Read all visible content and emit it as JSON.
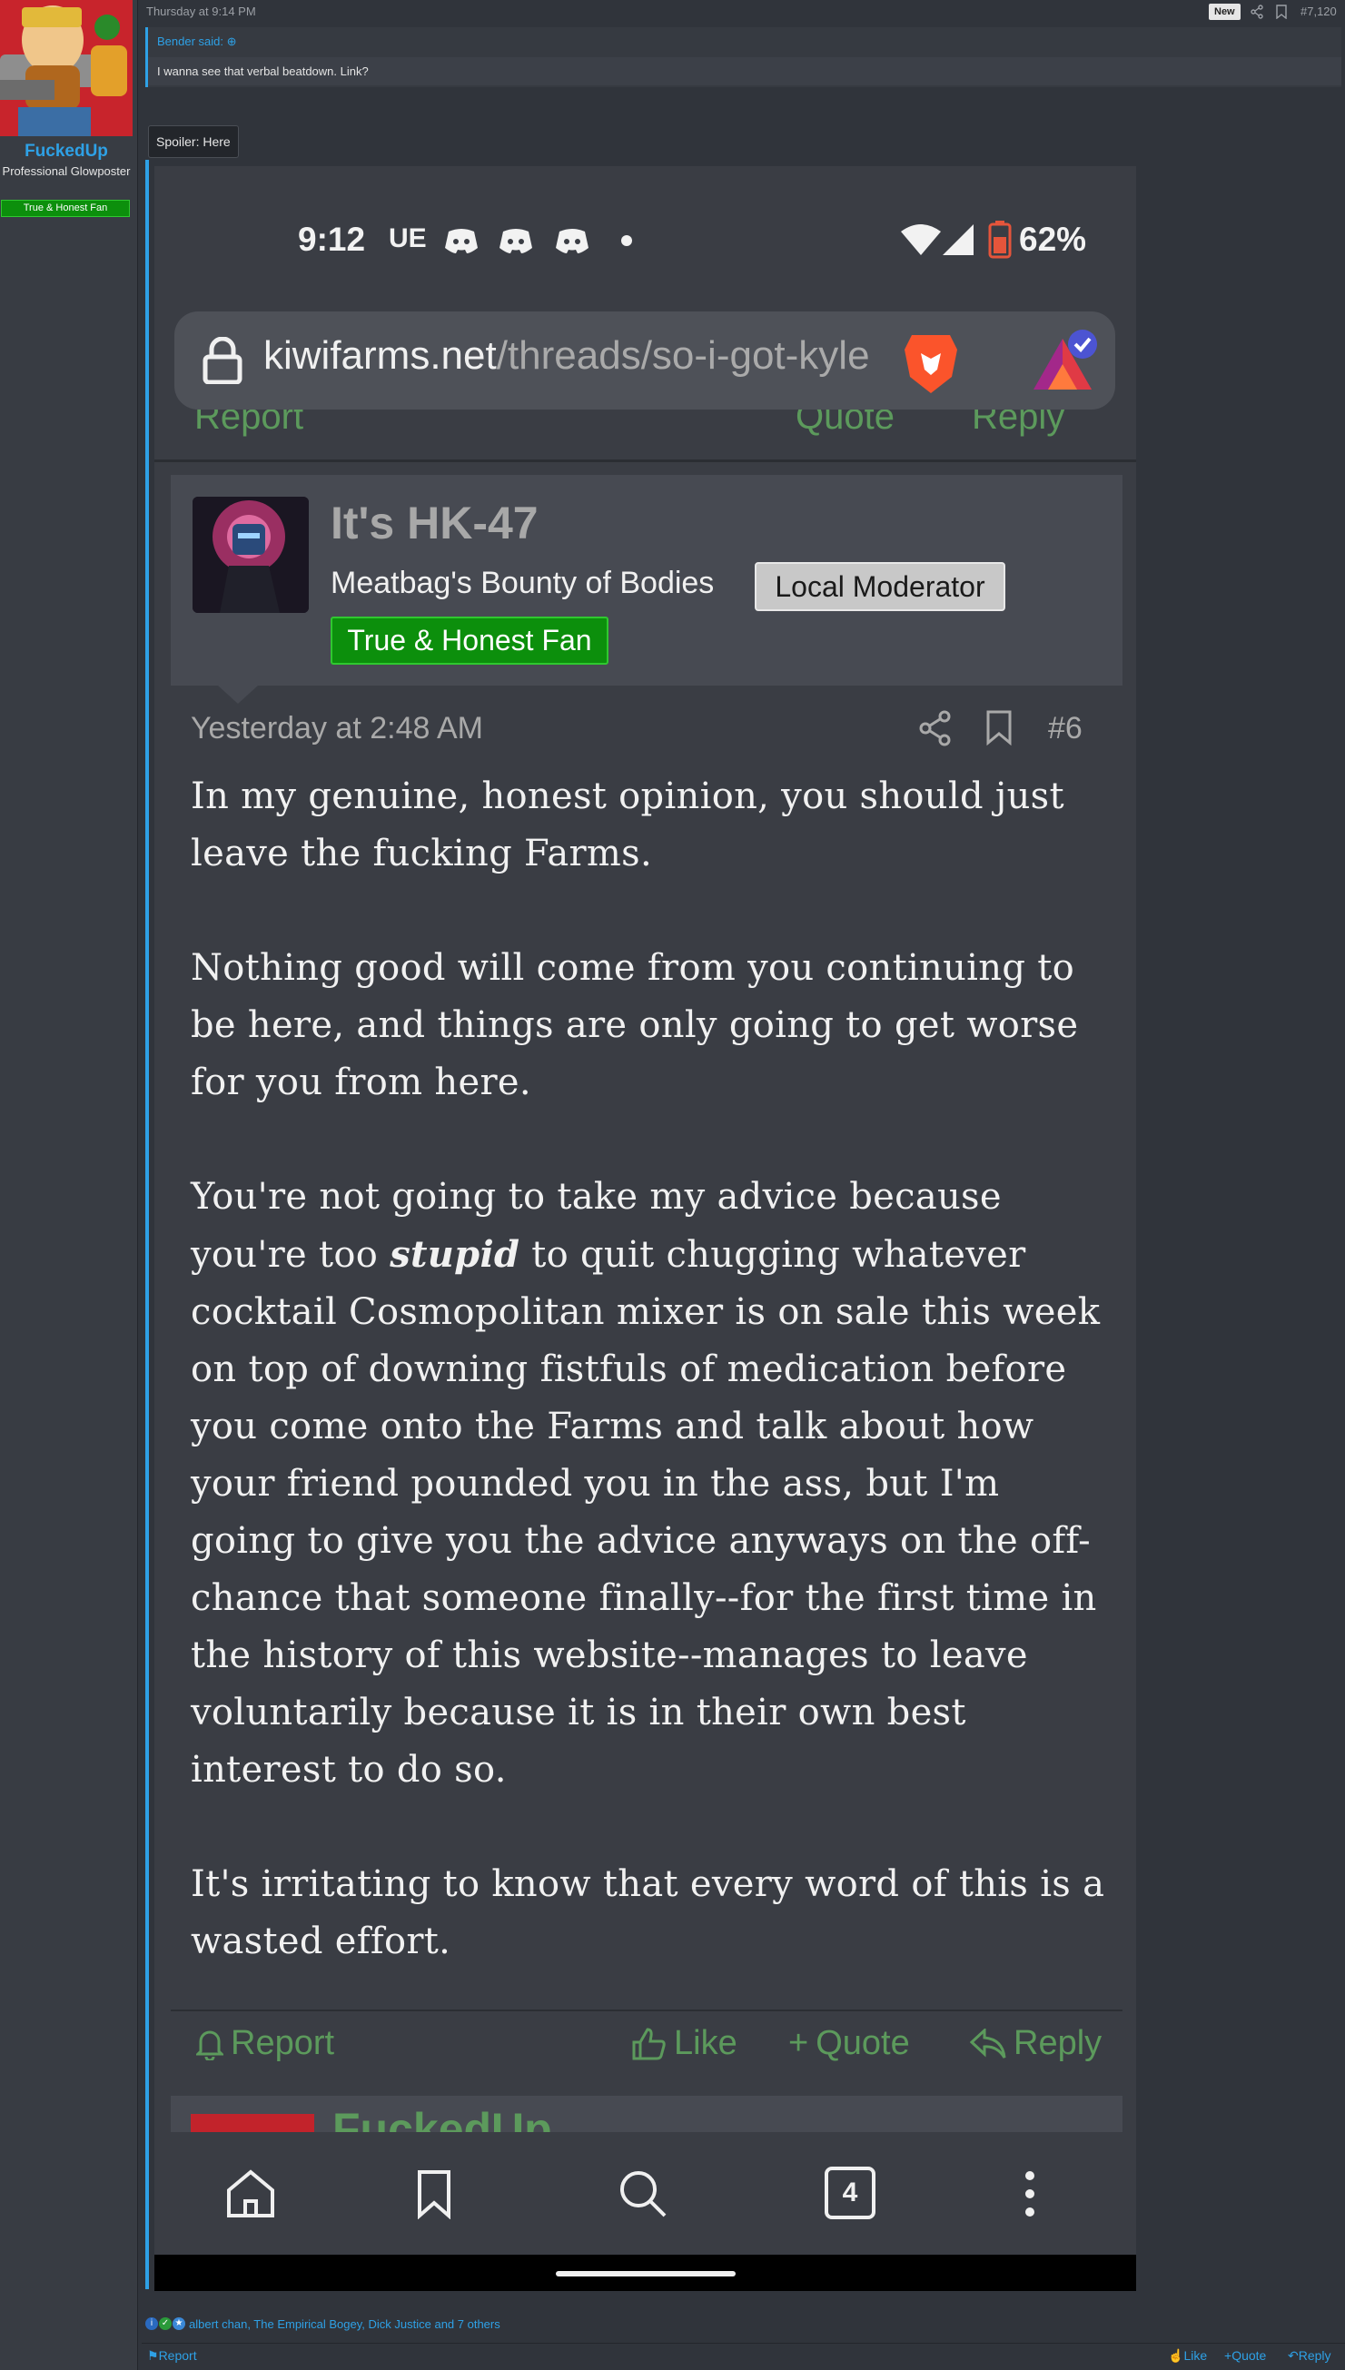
{
  "user": {
    "name": "FuckedUp",
    "title": "Professional Glowposter",
    "banner": "True & Honest Fan"
  },
  "post": {
    "date": "Thursday at 9:14 PM",
    "new_badge": "New",
    "number": "#7,120"
  },
  "quote": {
    "author": "Bender said:",
    "text": "I wanna see that verbal beatdown. Link?"
  },
  "spoiler": {
    "label": "Spoiler: Here"
  },
  "phone": {
    "status": {
      "time": "9:12",
      "carrier": "UE",
      "battery": "62%"
    },
    "browser": {
      "url_host": "kiwifarms.net",
      "url_path": "/threads/so-i-got-kyle"
    },
    "prev_actions": {
      "report": "Report",
      "quote": "Quote",
      "reply": "Reply"
    },
    "message": {
      "author": "It's HK-47",
      "user_title": "Meatbag's Bounty of Bodies",
      "mod_badge": "Local Moderator",
      "fan_badge": "True & Honest Fan",
      "date": "Yesterday at 2:48 AM",
      "number": "#6",
      "p1": "In my genuine, honest opinion, you should just leave the fucking Farms.",
      "p2": "Nothing good will come from you continuing to be here, and things are only going to get worse for you from here.",
      "p3_a": "You're not going to take my advice because you're too ",
      "p3_em": "stupid",
      "p3_b": " to quit chugging whatever cocktail Cosmopolitan mixer is on sale this week on top of downing fistfuls of medication before you come onto the Farms and talk about how your friend pounded you in the ass, but I'm going to give you the advice anyways on the off-chance that someone finally--for the first time in the history of this website--manages to leave voluntarily because it is in their own best interest to do so.",
      "p4": "It's irritating to know that every word of this is a wasted effort."
    },
    "actions": {
      "report": "Report",
      "like": "Like",
      "quote": "Quote",
      "reply": "Reply"
    },
    "next_author": "FuckedUp",
    "tab_count": "4"
  },
  "reactions": {
    "text": "albert chan, The Empirical Bogey, Dick Justice and 7 others"
  },
  "footer": {
    "report": "Report",
    "like": "Like",
    "quote": "Quote",
    "reply": "Reply"
  },
  "colors": {
    "link_blue": "#2ea1e6",
    "fan_green": "#0c8f0c",
    "action_green": "#5c9a5c"
  }
}
